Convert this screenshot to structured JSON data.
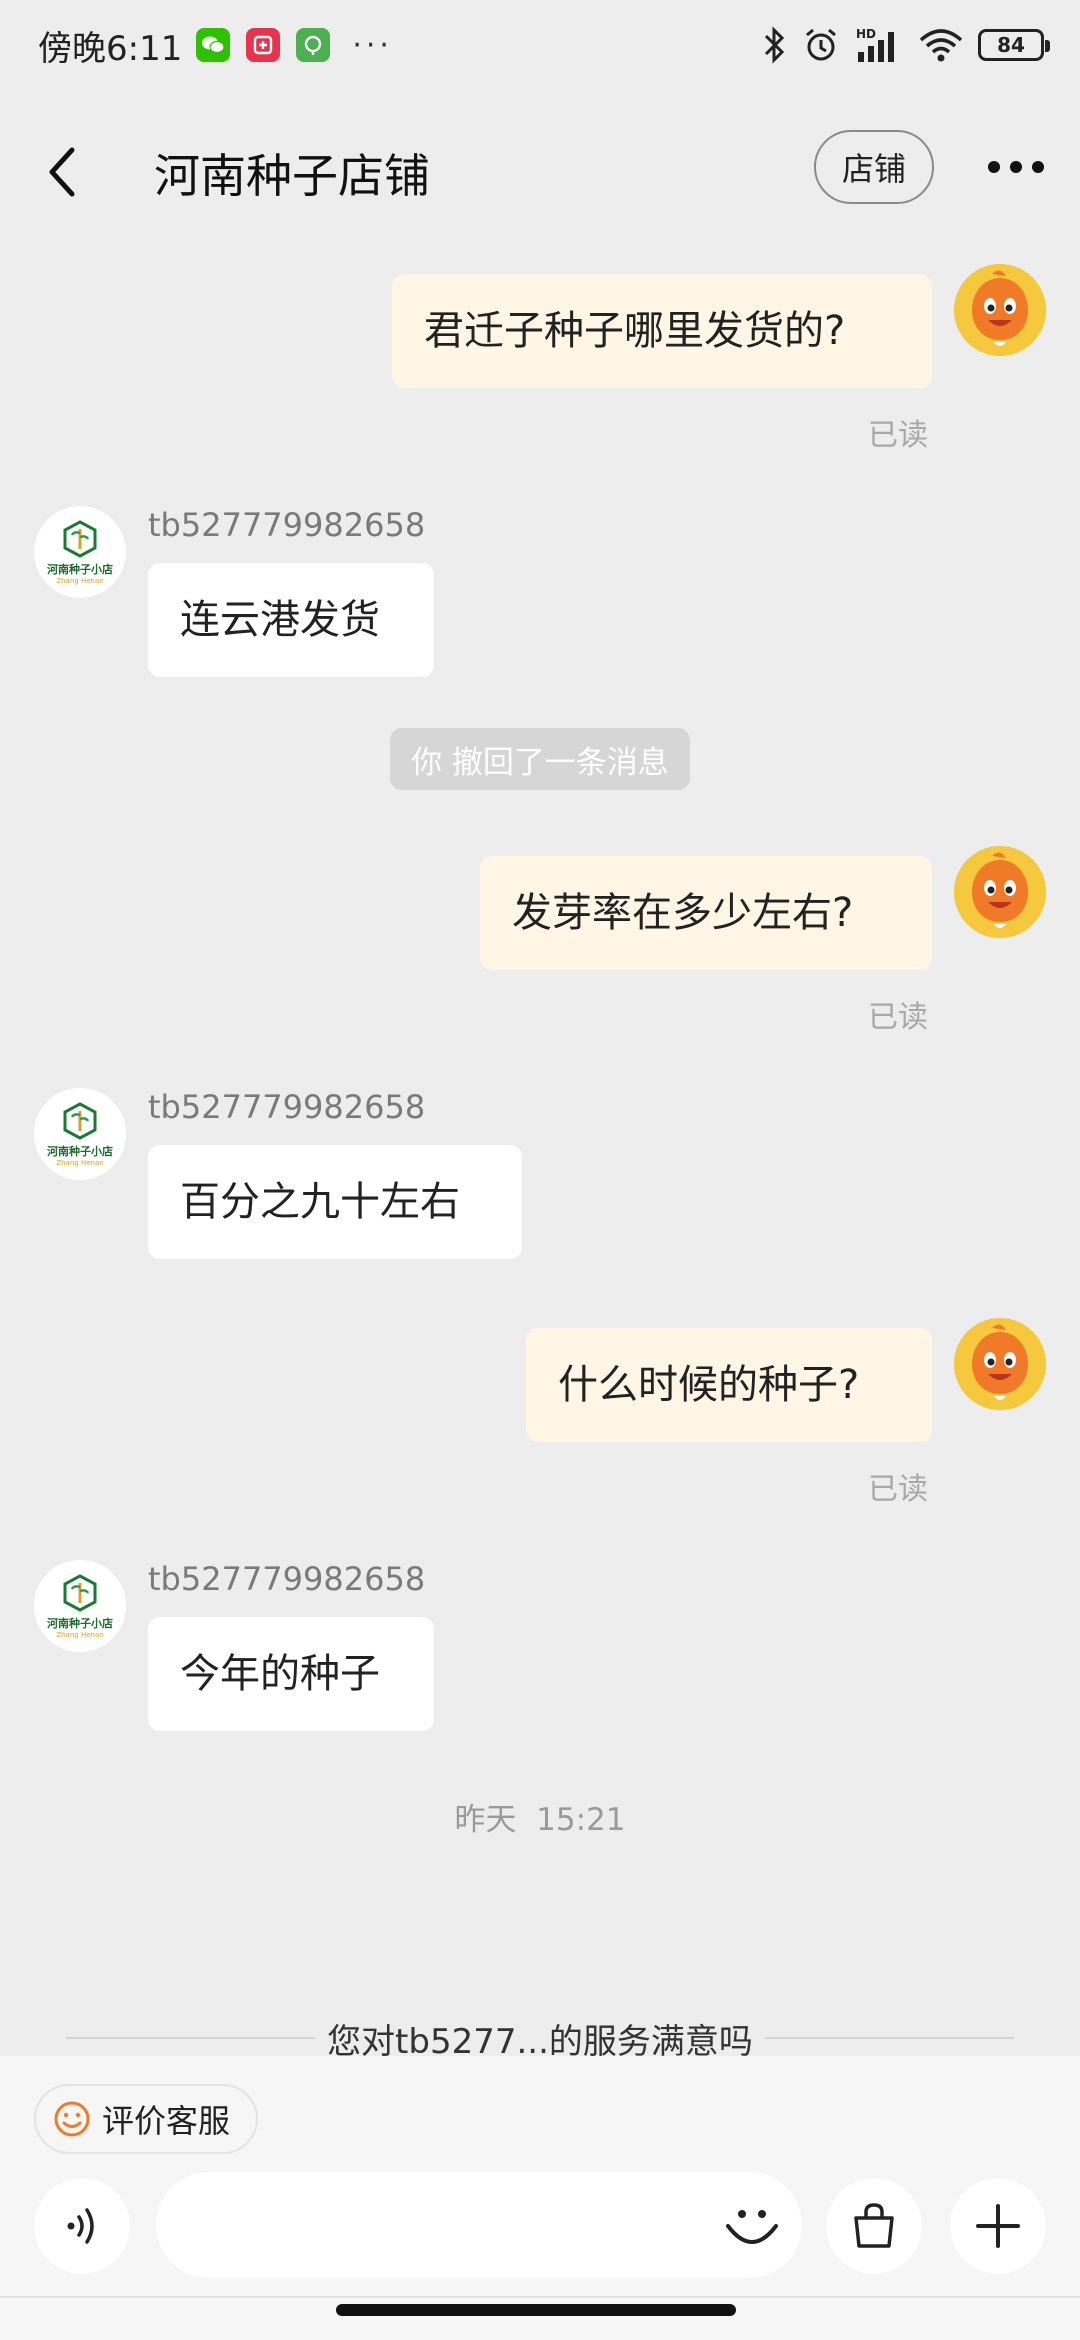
{
  "status_bar": {
    "time": "傍晚6:11",
    "dots": "···",
    "battery": "84",
    "network_label": "HD",
    "app_icons": [
      "wechat-icon",
      "taote-icon",
      "green-app-icon"
    ]
  },
  "header": {
    "title": "河南种子店铺",
    "shop_button": "店铺"
  },
  "messages": [
    {
      "from": "me",
      "text": "君迁子种子哪里发货的?",
      "status": "已读"
    },
    {
      "from": "shop",
      "sender": "tb527779982658",
      "text": "连云港发货"
    },
    {
      "from": "me",
      "text": "发芽率在多少左右?",
      "status": "已读"
    },
    {
      "from": "shop",
      "sender": "tb527779982658",
      "text": "百分之九十左右"
    },
    {
      "from": "me",
      "text": "什么时候的种子?",
      "status": "已读"
    },
    {
      "from": "shop",
      "sender": "tb527779982658",
      "text": "今年的种子"
    }
  ],
  "system_notice": "你 撤回了一条消息",
  "timestamp": "昨天  15:21",
  "satisfaction_prompt": "您对tb5277...的服务满意吗",
  "shop_avatar": {
    "logo_text": "河南种子小店",
    "logo_sub": "Zhang  Henan"
  },
  "bottom": {
    "rate_button": "评价客服",
    "input_placeholder": ""
  },
  "colors": {
    "background": "#ededed",
    "my_bubble": "#fff6e6",
    "their_bubble": "#ffffff",
    "accent_orange": "#f07a28"
  }
}
